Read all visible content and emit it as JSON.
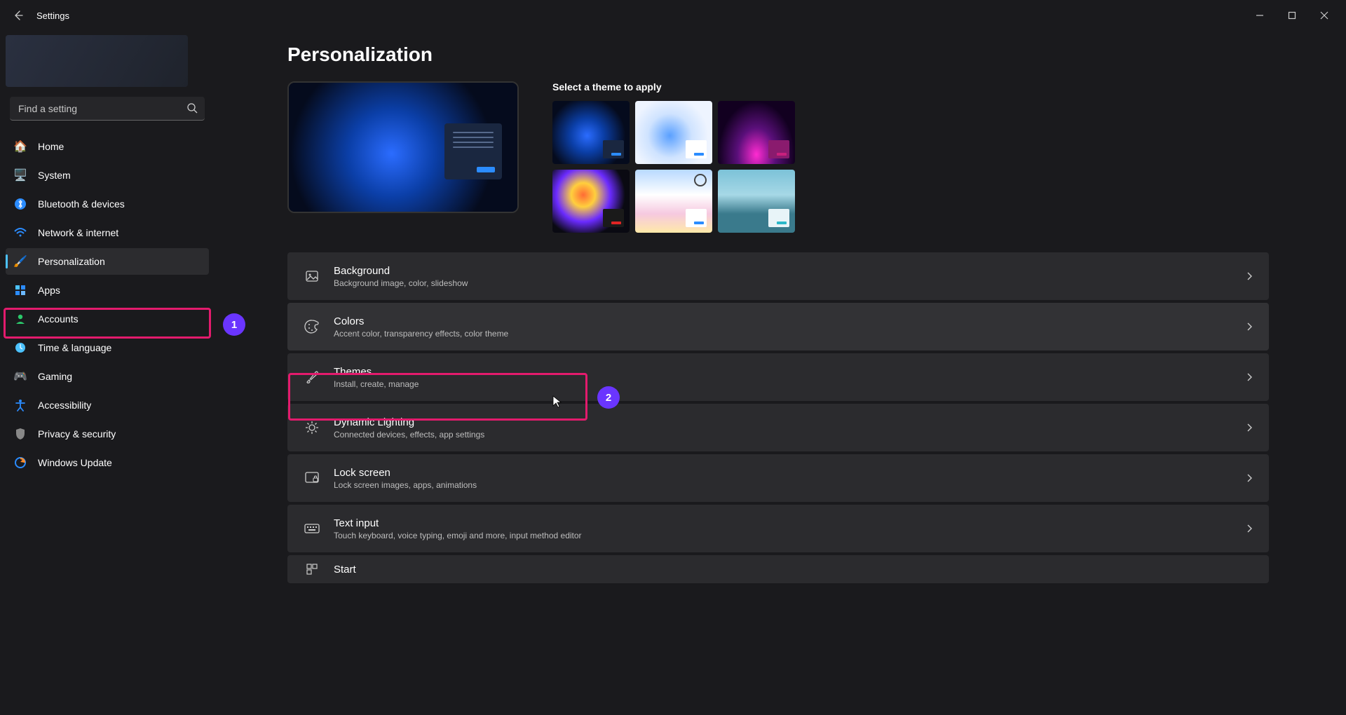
{
  "titlebar": {
    "title": "Settings"
  },
  "search": {
    "placeholder": "Find a setting"
  },
  "sidebar": {
    "items": [
      {
        "label": "Home"
      },
      {
        "label": "System"
      },
      {
        "label": "Bluetooth & devices"
      },
      {
        "label": "Network & internet"
      },
      {
        "label": "Personalization"
      },
      {
        "label": "Apps"
      },
      {
        "label": "Accounts"
      },
      {
        "label": "Time & language"
      },
      {
        "label": "Gaming"
      },
      {
        "label": "Accessibility"
      },
      {
        "label": "Privacy & security"
      },
      {
        "label": "Windows Update"
      }
    ],
    "active_index": 4
  },
  "page": {
    "title": "Personalization",
    "themes_heading": "Select a theme to apply"
  },
  "settings": [
    {
      "title": "Background",
      "subtitle": "Background image, color, slideshow"
    },
    {
      "title": "Colors",
      "subtitle": "Accent color, transparency effects, color theme"
    },
    {
      "title": "Themes",
      "subtitle": "Install, create, manage"
    },
    {
      "title": "Dynamic Lighting",
      "subtitle": "Connected devices, effects, app settings"
    },
    {
      "title": "Lock screen",
      "subtitle": "Lock screen images, apps, animations"
    },
    {
      "title": "Text input",
      "subtitle": "Touch keyboard, voice typing, emoji and more, input method editor"
    },
    {
      "title": "Start",
      "subtitle": ""
    }
  ],
  "annotations": {
    "badge1": "1",
    "badge2": "2"
  }
}
